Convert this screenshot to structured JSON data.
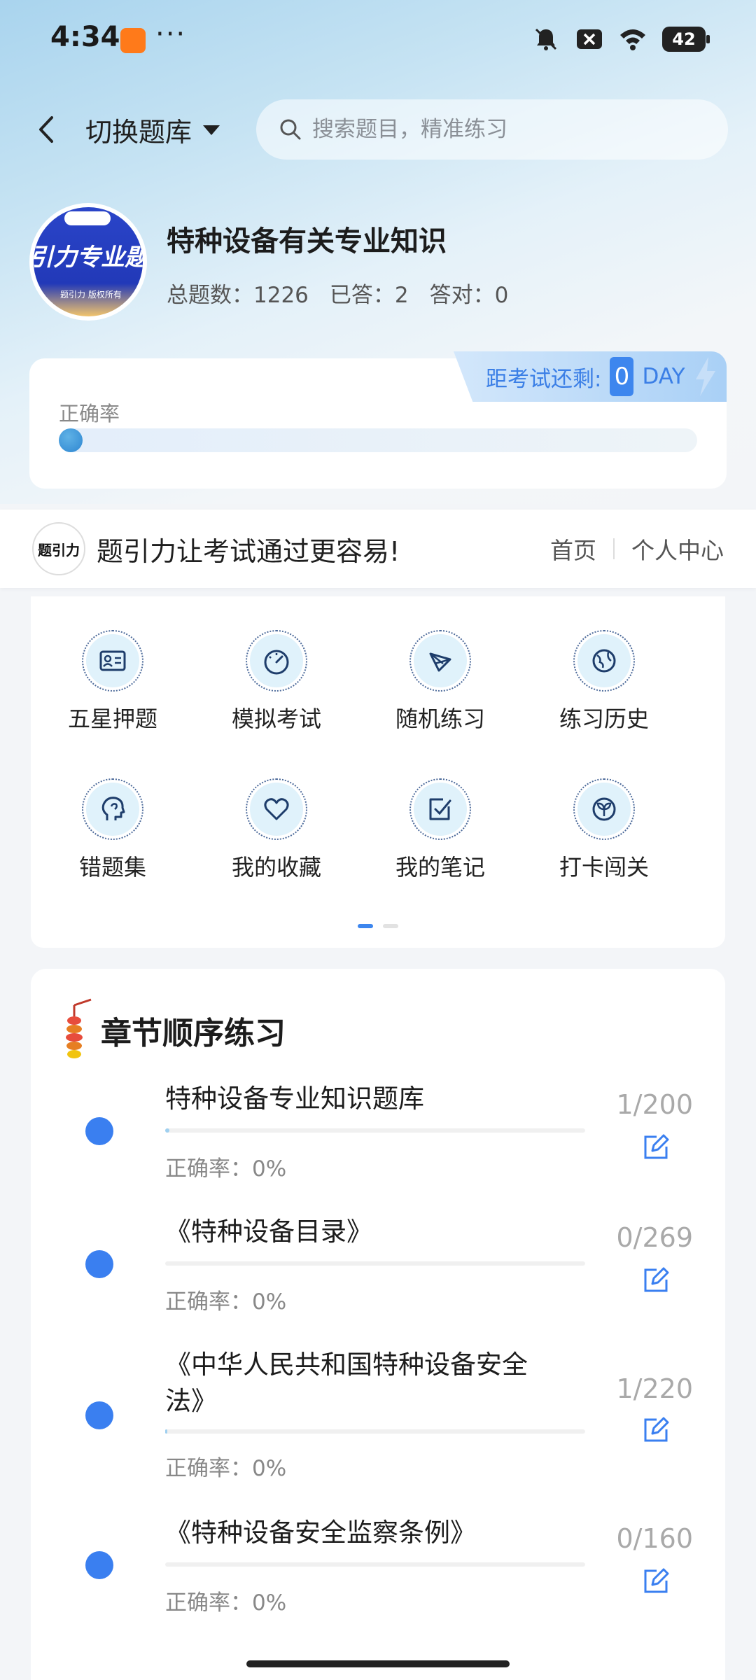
{
  "status_bar": {
    "time": "4:34",
    "dots": "···",
    "battery": "42"
  },
  "header": {
    "switch_label": "切换题库",
    "search_placeholder": "搜索题目，精准练习"
  },
  "bank": {
    "title": "特种设备有关专业知识",
    "logo_text": "引力专业题",
    "logo_sub": "题引力 版权所有",
    "stats": {
      "total_label": "总题数：",
      "total": "1226",
      "answered_label": "已答：",
      "answered": "2",
      "correct_label": "答对：",
      "correct": "0"
    }
  },
  "accuracy": {
    "label": "正确率",
    "value": 0.0
  },
  "countdown": {
    "label": "距考试还剩:",
    "days": "0",
    "unit": "DAY"
  },
  "brand": {
    "logo_text": "题引力",
    "slogan": "题引力让考试通过更容易!",
    "nav_home": "首页",
    "nav_profile": "个人中心"
  },
  "features": [
    {
      "label": "五星押题",
      "icon": "id-card-icon"
    },
    {
      "label": "模拟考试",
      "icon": "speedometer-icon"
    },
    {
      "label": "随机练习",
      "icon": "shuffle-icon"
    },
    {
      "label": "练习历史",
      "icon": "globe-icon"
    },
    {
      "label": "错题集",
      "icon": "head-icon"
    },
    {
      "label": "我的收藏",
      "icon": "heart-icon"
    },
    {
      "label": "我的笔记",
      "icon": "note-check-icon"
    },
    {
      "label": "打卡闯关",
      "icon": "sprout-icon"
    }
  ],
  "chapters": {
    "title": "章节顺序练习",
    "items": [
      {
        "name": "特种设备专业知识题库",
        "count": "1/200",
        "accuracy": "正确率：0%",
        "progress": 0.005
      },
      {
        "name": "《特种设备目录》",
        "count": "0/269",
        "accuracy": "正确率：0%",
        "progress": 0
      },
      {
        "name": "《中华人民共和国特种设备安全法》",
        "count": "1/220",
        "accuracy": "正确率：0%",
        "progress": 0.0045
      },
      {
        "name": "《特种设备安全监察条例》",
        "count": "0/160",
        "accuracy": "正确率：0%",
        "progress": 0
      }
    ]
  },
  "colors": {
    "accent": "#3a7ff0",
    "countdown_text": "#3b7fe6"
  }
}
